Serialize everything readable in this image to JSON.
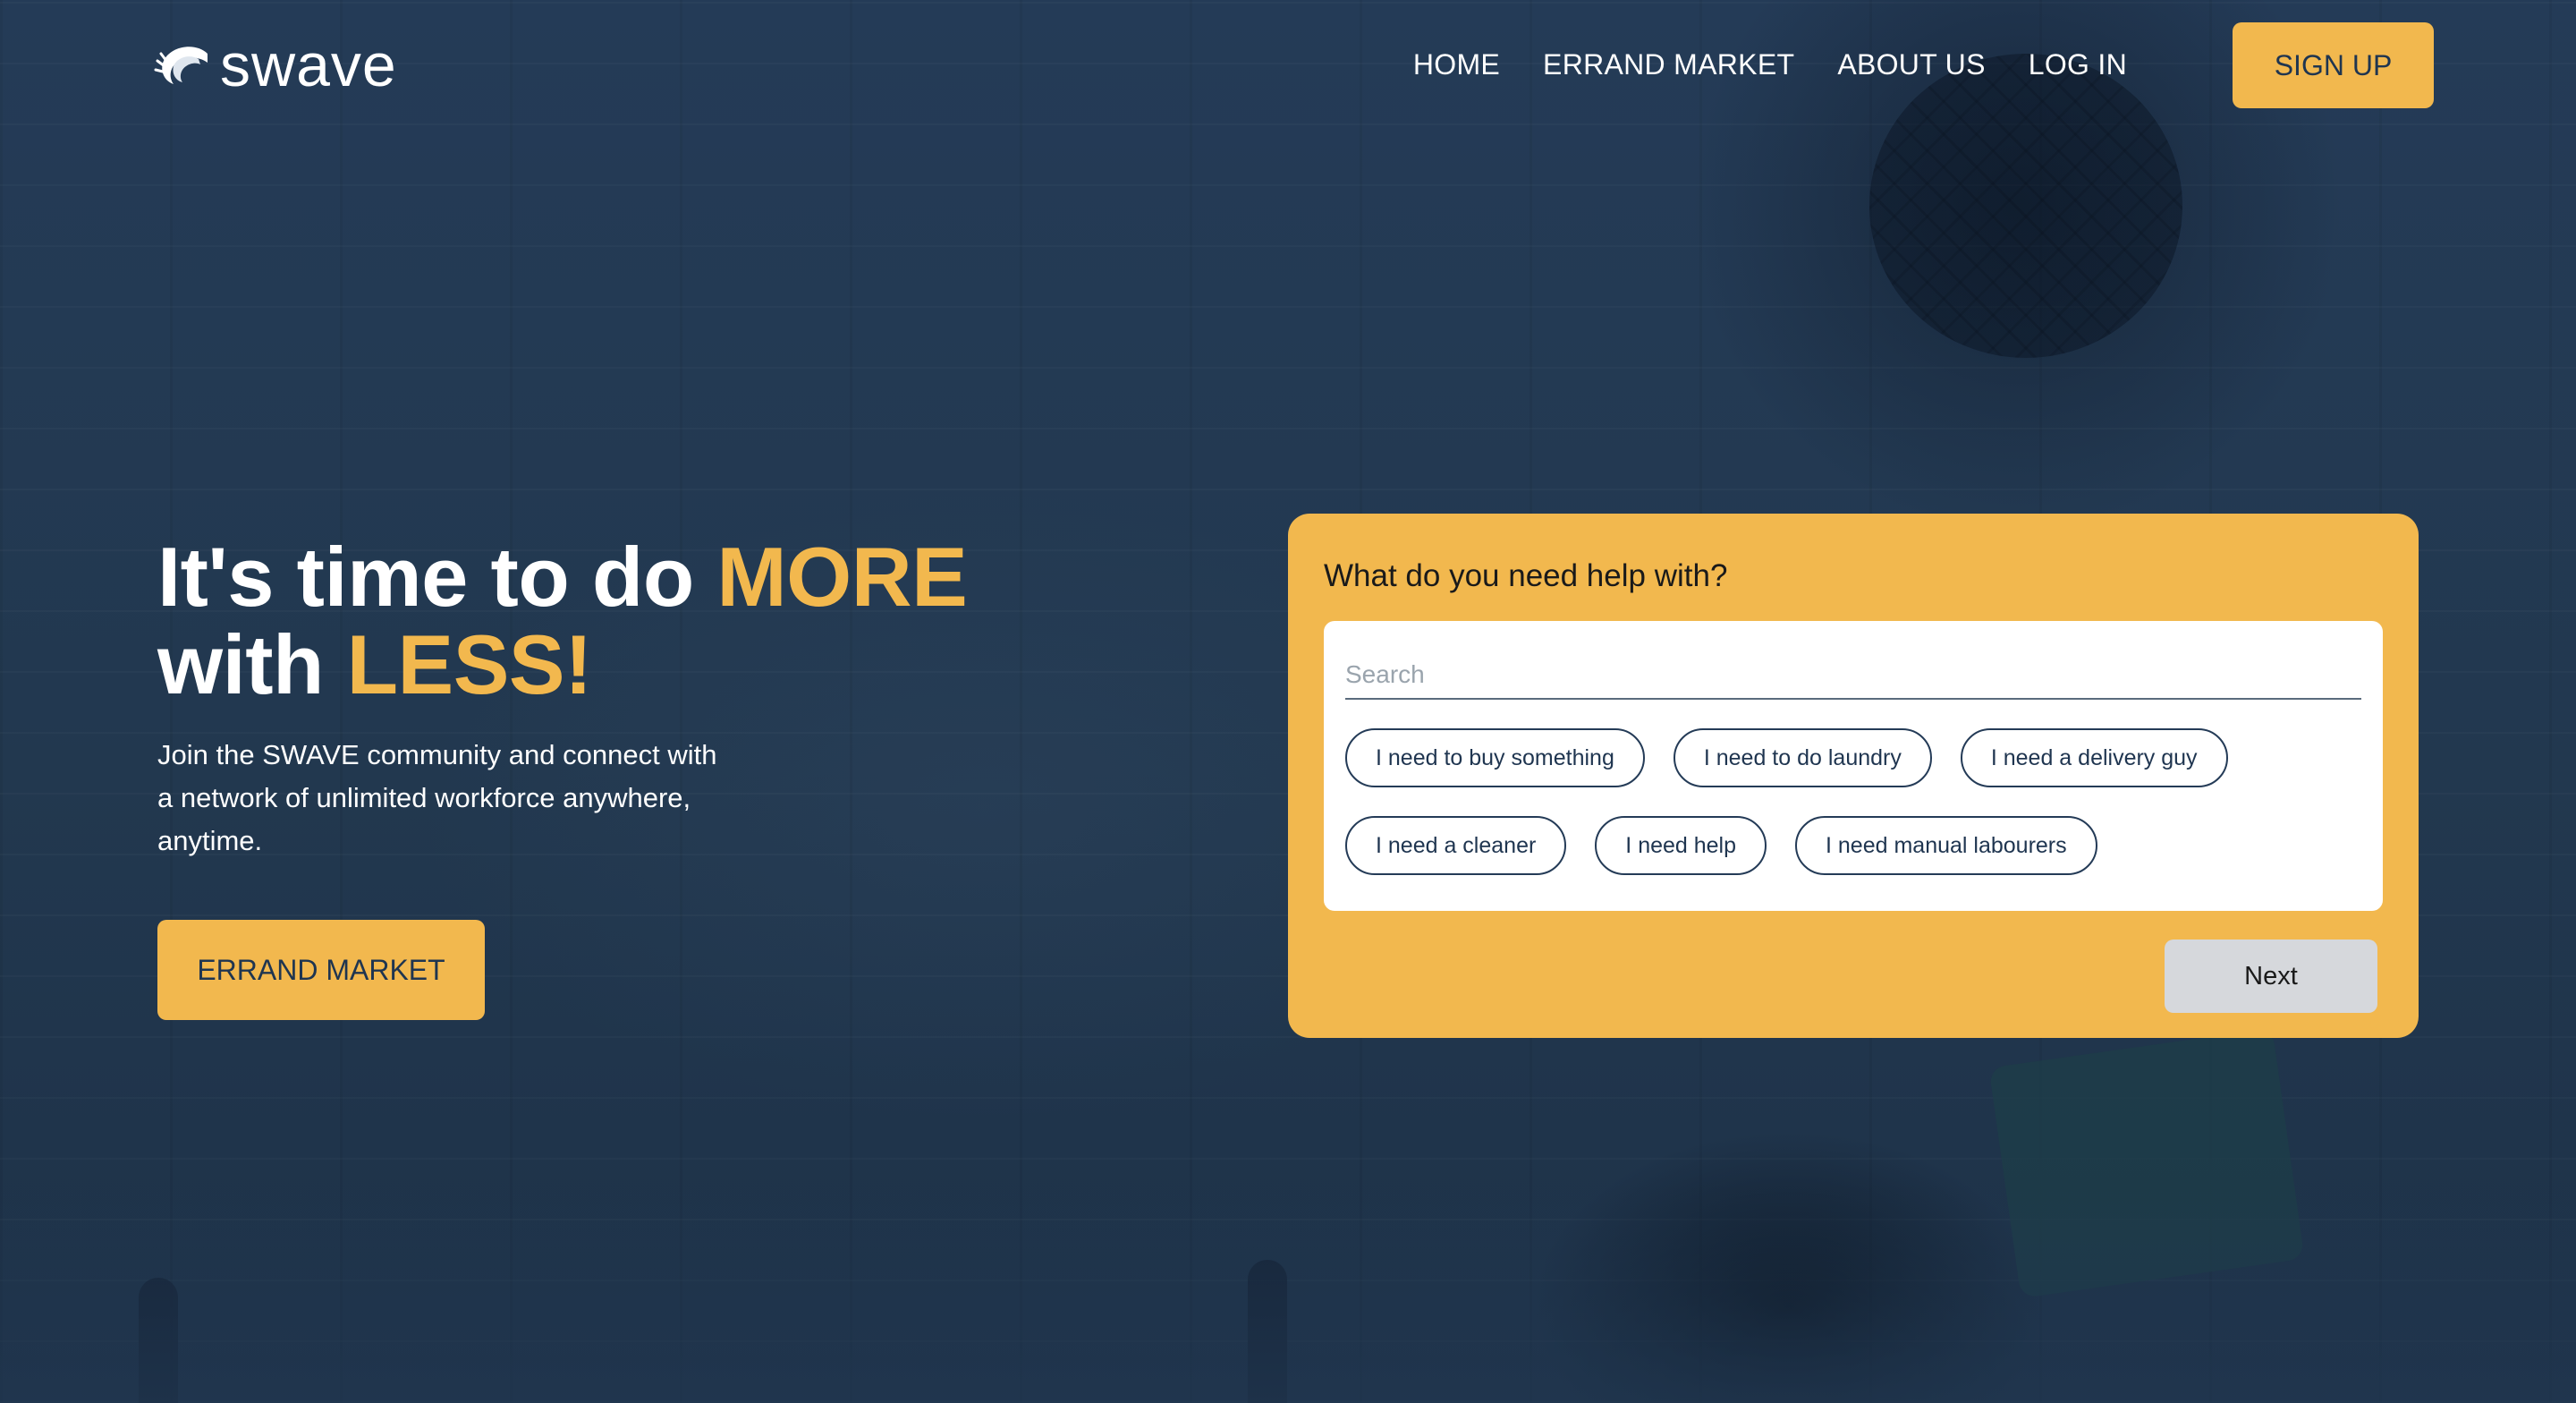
{
  "brand": {
    "name": "swave",
    "accent_color": "#f2b84e",
    "background_color": "#1f3550"
  },
  "nav": {
    "links": [
      {
        "label": "HOME"
      },
      {
        "label": "ERRAND MARKET"
      },
      {
        "label": "ABOUT US"
      },
      {
        "label": "LOG IN"
      }
    ],
    "signup_label": "SIGN UP"
  },
  "hero": {
    "headline_part1": "It's time to do ",
    "headline_accent1": "MORE",
    "headline_part2": "with ",
    "headline_accent2": "LESS!",
    "subtext": "Join the SWAVE community and connect with a network of unlimited workforce anywhere, anytime.",
    "cta_label": "ERRAND MARKET"
  },
  "help_card": {
    "title": "What do you need help with?",
    "search_placeholder": "Search",
    "search_value": "",
    "options_row1": [
      {
        "label": "I need to buy something"
      },
      {
        "label": "I need to do laundry"
      },
      {
        "label": "I need a delivery guy"
      }
    ],
    "options_row2": [
      {
        "label": "I need a cleaner"
      },
      {
        "label": "I need help"
      },
      {
        "label": "I need manual labourers"
      }
    ],
    "next_label": "Next"
  }
}
